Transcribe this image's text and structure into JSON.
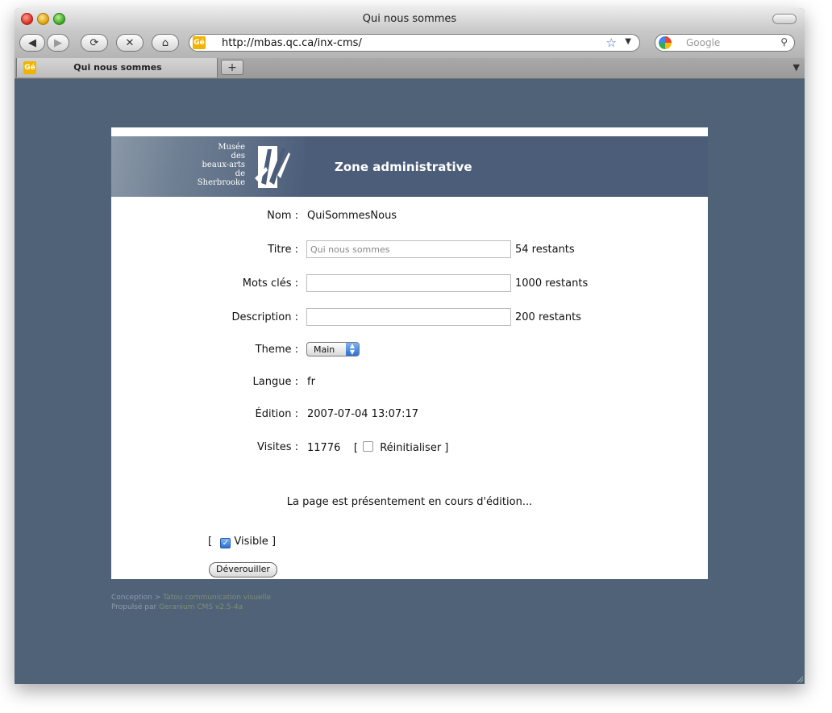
{
  "window": {
    "title": "Qui nous sommes"
  },
  "toolbar": {
    "url": "http://mbas.qc.ca/inx-cms/",
    "search_placeholder": "Google",
    "favicon_text": "Gé"
  },
  "tabs": [
    {
      "label": "Qui nous sommes",
      "favicon_text": "Gé"
    }
  ],
  "header": {
    "logo_lines": [
      "Musée",
      "des",
      "beaux-arts",
      "de",
      "Sherbrooke"
    ],
    "title": "Zone administrative"
  },
  "form": {
    "nom": {
      "label": "Nom :",
      "value": "QuiSommesNous"
    },
    "titre": {
      "label": "Titre :",
      "placeholder": "Qui nous sommes",
      "remaining": "54 restants"
    },
    "mots_cles": {
      "label": "Mots clés :",
      "value": "",
      "remaining": "1000 restants"
    },
    "description": {
      "label": "Description :",
      "value": "",
      "remaining": "200 restants"
    },
    "theme": {
      "label": "Theme :",
      "selected": "Main"
    },
    "langue": {
      "label": "Langue :",
      "value": "fr"
    },
    "edition": {
      "label": "Édition :",
      "value": "2007-07-04 13:07:17"
    },
    "visites": {
      "label": "Visites :",
      "value": "11776",
      "reset_label": "Réinitialiser"
    }
  },
  "status_message": "La page est présentement en cours d'édition...",
  "visible_label": "Visible",
  "unlock_button": "Déverouiller",
  "footer": {
    "conception_prefix": "Conception >",
    "conception_link": "Tatou communication visuelle",
    "powered_prefix": "Propulsé par",
    "powered_link": "Geranium CMS v2.5-4a"
  },
  "colors": {
    "page_background": "#506278",
    "header_background": "#4b5d79",
    "footer_link": "#7f8e72"
  }
}
